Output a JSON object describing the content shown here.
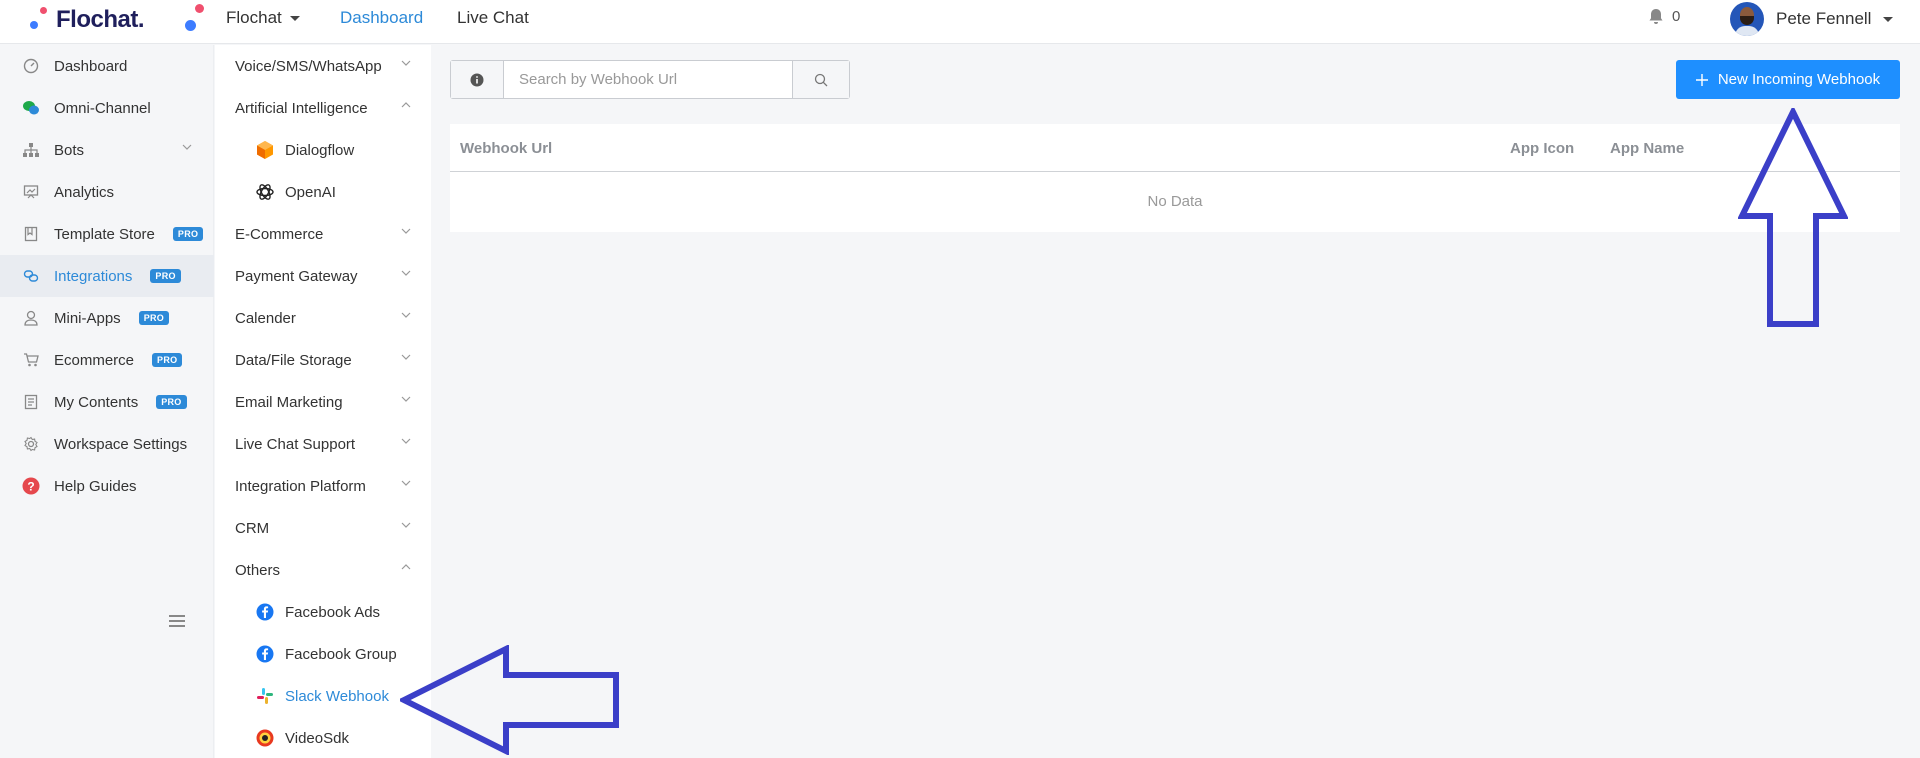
{
  "app": {
    "logo_text": "Flochat.",
    "workspace_name": "Flochat",
    "colors": {
      "accent": "#2d8ad8",
      "primary_button": "#1e8fff",
      "annotation": "#3b3fc8"
    }
  },
  "topnav": {
    "links": [
      "Dashboard",
      "Live Chat"
    ],
    "active": "Dashboard",
    "notifications_count": "0",
    "user_name": "Pete Fennell"
  },
  "sidebar": {
    "items": [
      {
        "label": "Dashboard",
        "icon": "dashboard-icon"
      },
      {
        "label": "Omni-Channel",
        "icon": "chat-bubbles-icon"
      },
      {
        "label": "Bots",
        "icon": "org-chart-icon",
        "expandable": true
      },
      {
        "label": "Analytics",
        "icon": "presentation-chart-icon"
      },
      {
        "label": "Template Store",
        "icon": "book-icon",
        "badge": "PRO"
      },
      {
        "label": "Integrations",
        "icon": "link-icon",
        "badge": "PRO",
        "active": true
      },
      {
        "label": "Mini-Apps",
        "icon": "person-icon",
        "badge": "PRO"
      },
      {
        "label": "Ecommerce",
        "icon": "cart-icon",
        "badge": "PRO"
      },
      {
        "label": "My Contents",
        "icon": "document-icon",
        "badge": "PRO"
      },
      {
        "label": "Workspace Settings",
        "icon": "gear-icon"
      },
      {
        "label": "Help Guides",
        "icon": "help-icon"
      }
    ]
  },
  "integrations_menu": {
    "categories": [
      {
        "label": "Voice/SMS/WhatsApp",
        "expanded": false
      },
      {
        "label": "Artificial Intelligence",
        "expanded": true
      },
      {
        "label": "E-Commerce",
        "expanded": false
      },
      {
        "label": "Payment Gateway",
        "expanded": false
      },
      {
        "label": "Calender",
        "expanded": false
      },
      {
        "label": "Data/File Storage",
        "expanded": false
      },
      {
        "label": "Email Marketing",
        "expanded": false
      },
      {
        "label": "Live Chat Support",
        "expanded": false
      },
      {
        "label": "Integration Platform",
        "expanded": false
      },
      {
        "label": "CRM",
        "expanded": false
      },
      {
        "label": "Others",
        "expanded": true
      }
    ],
    "ai_children": [
      {
        "label": "Dialogflow",
        "icon": "dialogflow-icon"
      },
      {
        "label": "OpenAI",
        "icon": "openai-icon"
      }
    ],
    "others_children": [
      {
        "label": "Facebook Ads",
        "icon": "facebook-icon"
      },
      {
        "label": "Facebook Group",
        "icon": "facebook-icon"
      },
      {
        "label": "Slack Webhook",
        "icon": "slack-icon",
        "active": true
      },
      {
        "label": "VideoSdk",
        "icon": "videosdk-icon"
      }
    ]
  },
  "main": {
    "search": {
      "placeholder": "Search by Webhook Url",
      "value": ""
    },
    "new_button_label": "New Incoming Webhook",
    "table": {
      "columns": [
        "Webhook Url",
        "App Icon",
        "App Name"
      ],
      "rows": [],
      "empty_text": "No Data"
    }
  }
}
